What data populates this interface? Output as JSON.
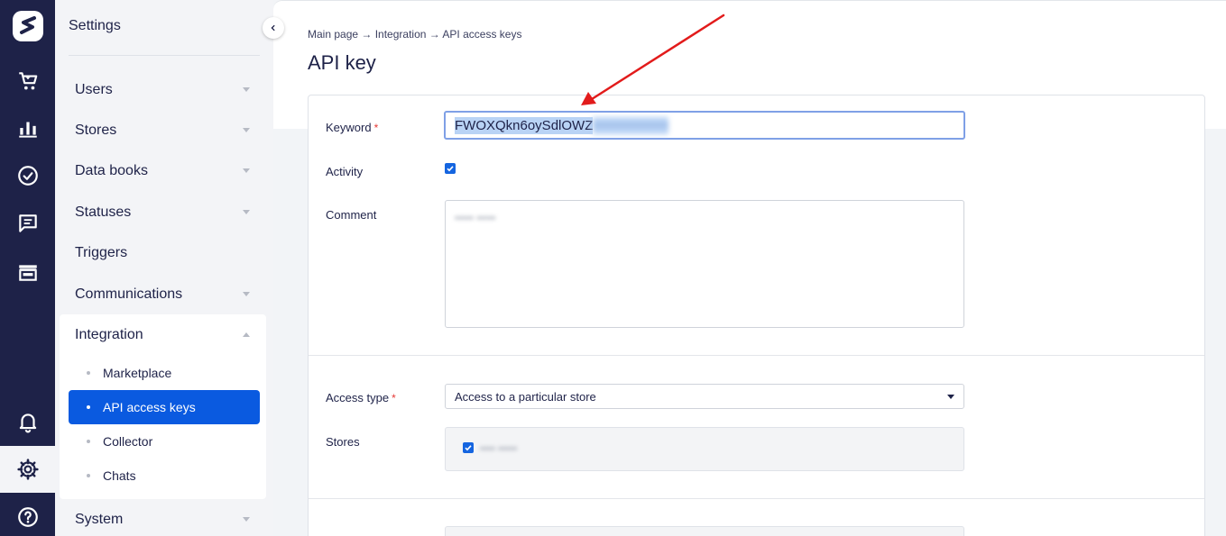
{
  "sidebar": {
    "title": "Settings",
    "items": [
      {
        "label": "Users",
        "caret": "down"
      },
      {
        "label": "Stores",
        "caret": "down"
      },
      {
        "label": "Data books",
        "caret": "down"
      },
      {
        "label": "Statuses",
        "caret": "down"
      },
      {
        "label": "Triggers",
        "caret": "none"
      },
      {
        "label": "Communications",
        "caret": "down"
      },
      {
        "label": "Integration",
        "caret": "up"
      },
      {
        "label": "System",
        "caret": "down"
      }
    ],
    "integration_subitems": [
      {
        "label": "Marketplace",
        "active": false
      },
      {
        "label": "API access keys",
        "active": true
      },
      {
        "label": "Collector",
        "active": false
      },
      {
        "label": "Chats",
        "active": false
      }
    ]
  },
  "rail": {
    "icons": [
      "logo-icon",
      "cart-icon",
      "analytics-icon",
      "tasks-icon",
      "chat-icon",
      "store-icon",
      "bell-icon",
      "gear-icon",
      "help-icon"
    ],
    "active": "gear-icon"
  },
  "main": {
    "breadcrumb": "Main page → Integration → API access keys",
    "title": "API key",
    "form": {
      "keyword_label": "Keyword",
      "keyword_value_visible": "FWOXQkn6oySdlOWZ",
      "keyword_value_hidden": "••••••••••••••••",
      "activity_label": "Activity",
      "activity_checked": true,
      "comment_label": "Comment",
      "comment_value_hidden": "••••• •••••",
      "access_type_label": "Access type",
      "access_type_value": "Access to a particular store",
      "stores_label": "Stores",
      "stores_value_hidden": "•••• •••••",
      "required_mark": "*"
    }
  },
  "colors": {
    "rail_bg": "#1e2248",
    "accent": "#0a5ae0",
    "required": "#e53935",
    "annotation_arrow": "#e21b1b"
  }
}
